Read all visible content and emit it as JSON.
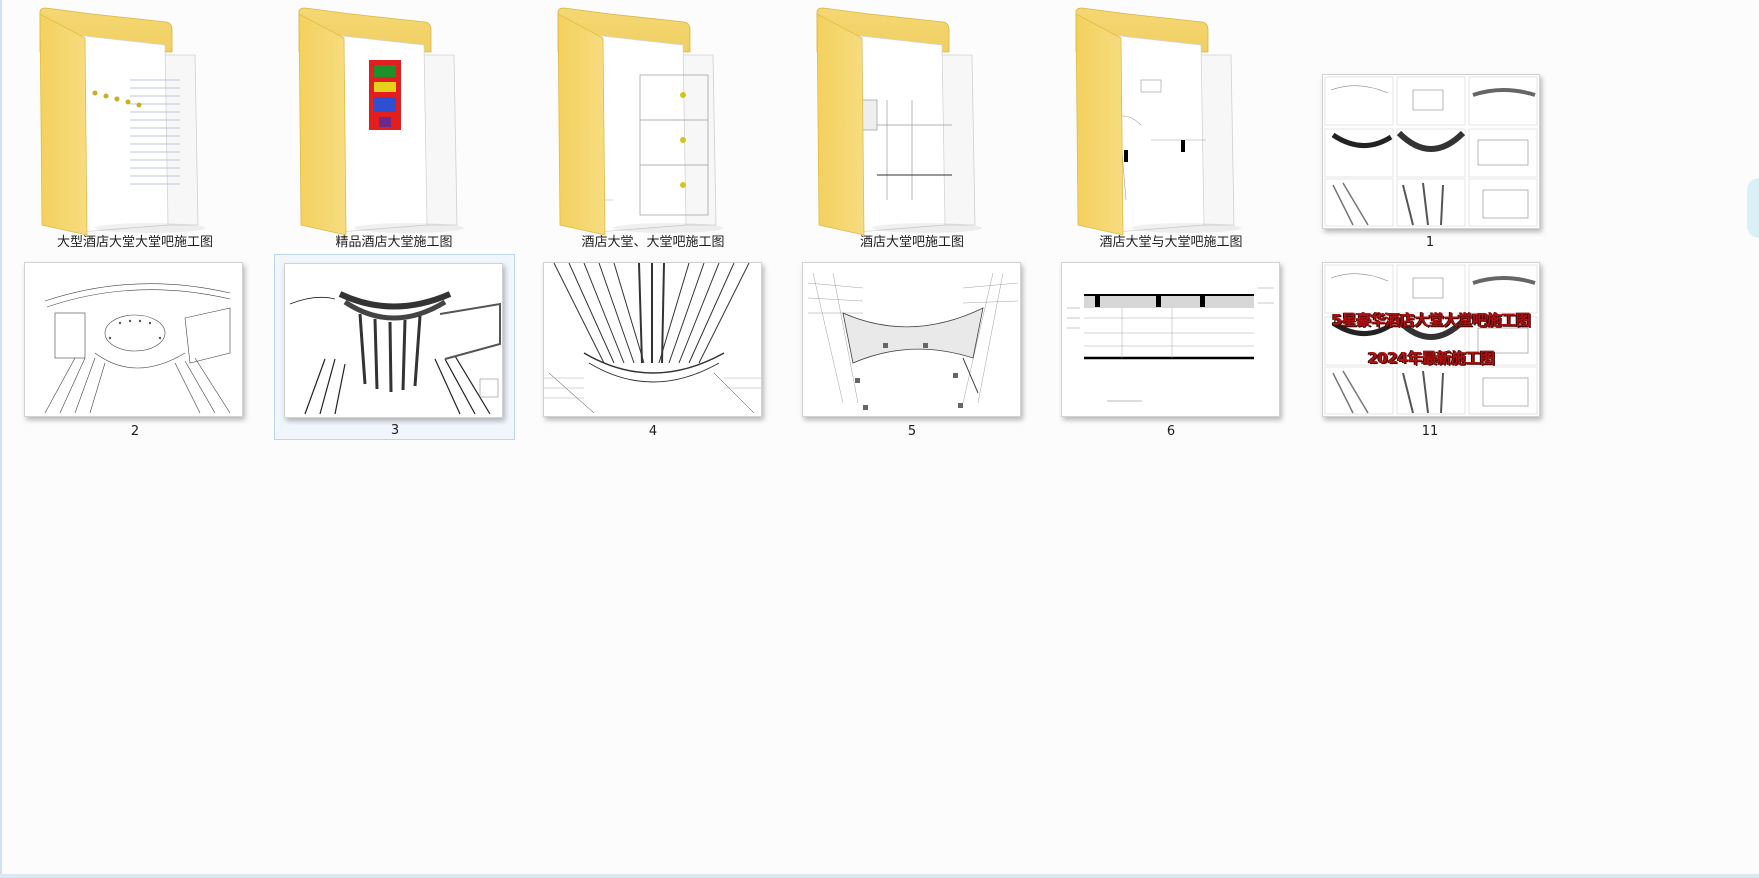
{
  "view_mode": "large-icons",
  "items": [
    {
      "kind": "folder",
      "label": "大型酒店大堂大堂吧施工图",
      "preview": "ruled-sheets"
    },
    {
      "kind": "folder",
      "label": "精品酒店大堂施工图",
      "preview": "colorful-sheet"
    },
    {
      "kind": "folder",
      "label": "酒店大堂、大堂吧施工图",
      "preview": "elevation-sheets"
    },
    {
      "kind": "folder",
      "label": "酒店大堂吧施工图",
      "preview": "section-sheets"
    },
    {
      "kind": "folder",
      "label": "酒店大堂与大堂吧施工图",
      "preview": "plan-sheets"
    },
    {
      "kind": "image",
      "label": "1",
      "preview": "drawing-collage"
    },
    {
      "kind": "image",
      "label": "2",
      "preview": "floor-plan"
    },
    {
      "kind": "image",
      "label": "3",
      "preview": "dense-floor-plan",
      "selected": true
    },
    {
      "kind": "image",
      "label": "4",
      "preview": "ceiling-plan"
    },
    {
      "kind": "image",
      "label": "5",
      "preview": "furniture-plan"
    },
    {
      "kind": "image",
      "label": "6",
      "preview": "elevation"
    },
    {
      "kind": "image",
      "label": "11",
      "preview": "cover-collage",
      "overlay": {
        "line1": "5星豪华酒店大堂大堂吧施工图",
        "line2": "2024年最新施工图"
      }
    }
  ],
  "colors": {
    "folder_front": "#f7dc80",
    "folder_back": "#f0cf62",
    "selection": "#f1f6fd",
    "overlay_text": "#b01010"
  }
}
